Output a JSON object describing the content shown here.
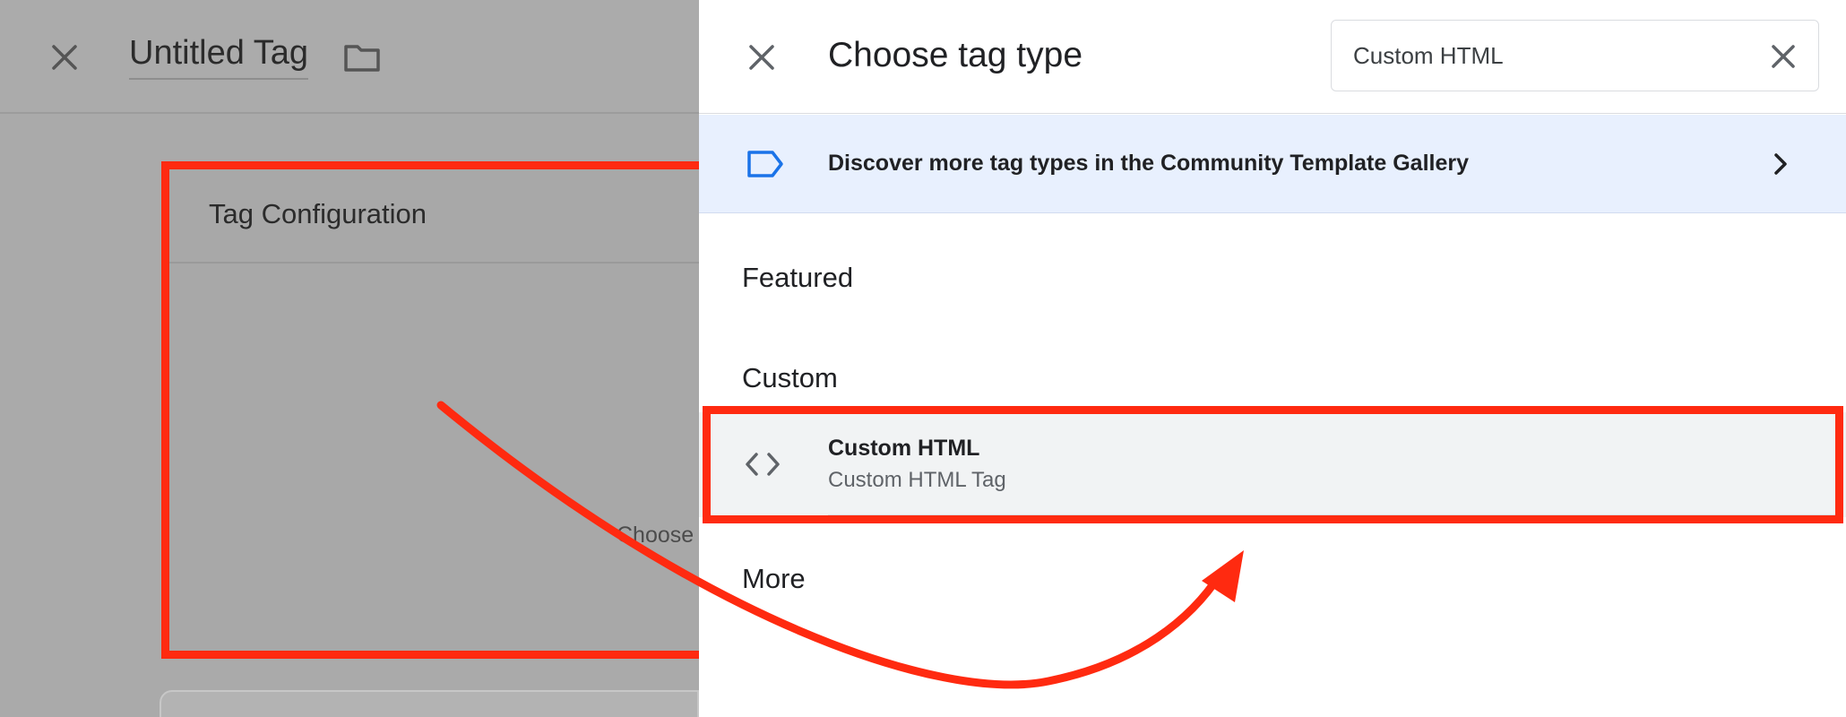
{
  "editor": {
    "tag_name": "Untitled Tag",
    "config_title": "Tag Configuration",
    "choose_hint": "Choose"
  },
  "panel": {
    "title": "Choose tag type",
    "search": {
      "value": "Custom HTML",
      "placeholder": ""
    },
    "gallery_banner": "Discover more tag types in the Community Template Gallery",
    "sections": {
      "featured": "Featured",
      "custom": "Custom",
      "more": "More"
    },
    "custom_items": [
      {
        "title": "Custom HTML",
        "subtitle": "Custom HTML Tag",
        "icon": "code-brackets-icon"
      }
    ]
  },
  "colors": {
    "annotation": "#ff2a10",
    "banner_bg": "#e8f0fe",
    "accent_blue": "#1a73e8",
    "row_selected_bg": "#f1f3f4",
    "dim_overlay": "#ababab"
  },
  "icons": [
    "close-icon",
    "folder-icon",
    "tag-label-icon",
    "chevron-right-icon",
    "code-brackets-icon"
  ]
}
